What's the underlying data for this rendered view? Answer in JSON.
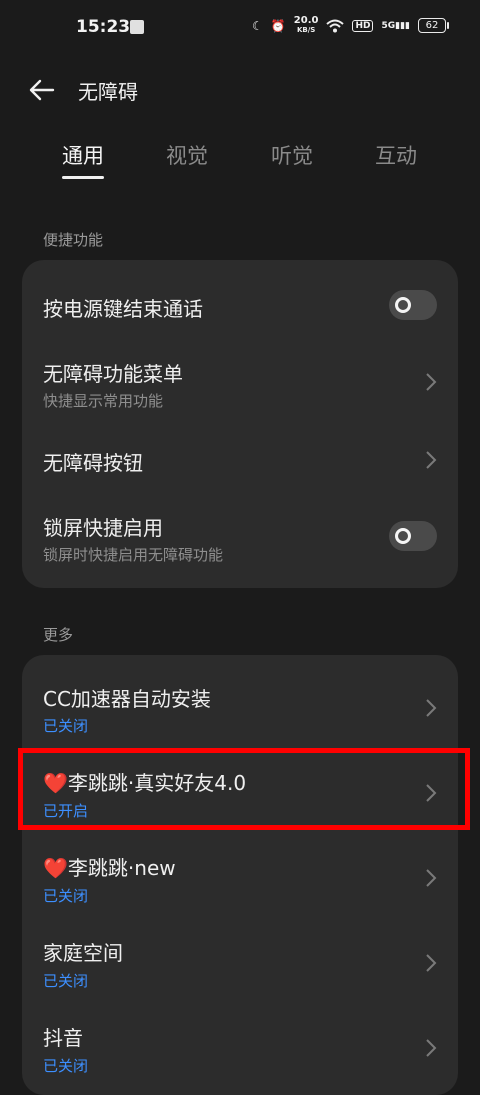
{
  "status_bar": {
    "time": "15:23",
    "speed_value": "20.0",
    "speed_unit": "KB/S",
    "hd": "HD",
    "network": "5G",
    "battery": "62"
  },
  "header": {
    "title": "无障碍"
  },
  "tabs": [
    {
      "label": "通用",
      "active": true
    },
    {
      "label": "视觉",
      "active": false
    },
    {
      "label": "听觉",
      "active": false
    },
    {
      "label": "互动",
      "active": false
    }
  ],
  "sections": [
    {
      "label": "便捷功能",
      "items": [
        {
          "title": "按电源键结束通话",
          "control": "toggle",
          "on": false
        },
        {
          "title": "无障碍功能菜单",
          "subtitle": "快捷显示常用功能",
          "control": "chevron"
        },
        {
          "title": "无障碍按钮",
          "control": "chevron"
        },
        {
          "title": "锁屏快捷启用",
          "subtitle": "锁屏时快捷启用无障碍功能",
          "control": "toggle",
          "on": false
        }
      ]
    },
    {
      "label": "更多",
      "items": [
        {
          "title": "CC加速器自动安装",
          "status": "已关闭",
          "control": "chevron"
        },
        {
          "heart": "❤️",
          "title": "李跳跳·真实好友4.0",
          "status": "已开启",
          "control": "chevron",
          "highlighted": true
        },
        {
          "heart": "❤️",
          "title": "李跳跳·new",
          "status": "已关闭",
          "control": "chevron"
        },
        {
          "title": "家庭空间",
          "status": "已关闭",
          "control": "chevron"
        },
        {
          "title": "抖音",
          "status": "已关闭",
          "control": "chevron"
        }
      ]
    }
  ],
  "colors": {
    "background": "#1b1b1b",
    "card": "#2c2c2c",
    "status_blue": "#3d8fff",
    "highlight_red": "#ff0000"
  }
}
